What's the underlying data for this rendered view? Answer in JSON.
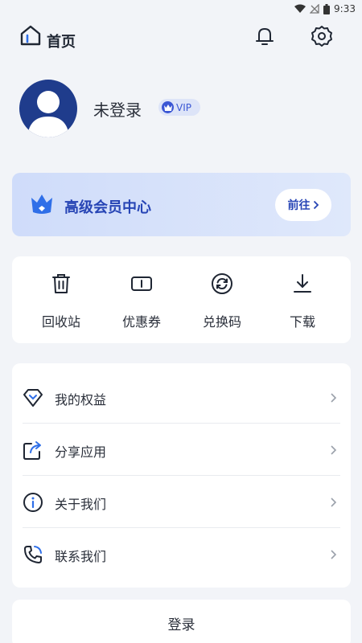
{
  "status_bar": {
    "time": "9:33"
  },
  "header": {
    "title": "首页"
  },
  "profile": {
    "username": "未登录",
    "vip_label": "VIP"
  },
  "vip_card": {
    "title": "高级会员中心",
    "button_label": "前往"
  },
  "actions": [
    {
      "label": "回收站",
      "icon": "trash-icon"
    },
    {
      "label": "优惠券",
      "icon": "coupon-icon"
    },
    {
      "label": "兑换码",
      "icon": "refresh-icon"
    },
    {
      "label": "下载",
      "icon": "download-icon"
    }
  ],
  "menu": [
    {
      "label": "我的权益",
      "icon": "diamond-icon"
    },
    {
      "label": "分享应用",
      "icon": "share-icon"
    },
    {
      "label": "关于我们",
      "icon": "info-icon"
    },
    {
      "label": "联系我们",
      "icon": "phone-icon"
    }
  ],
  "login_button": "登录",
  "colors": {
    "accent": "#2745b5",
    "background": "#f2f4f8",
    "card": "#ffffff",
    "avatar": "#1f3c8c"
  }
}
